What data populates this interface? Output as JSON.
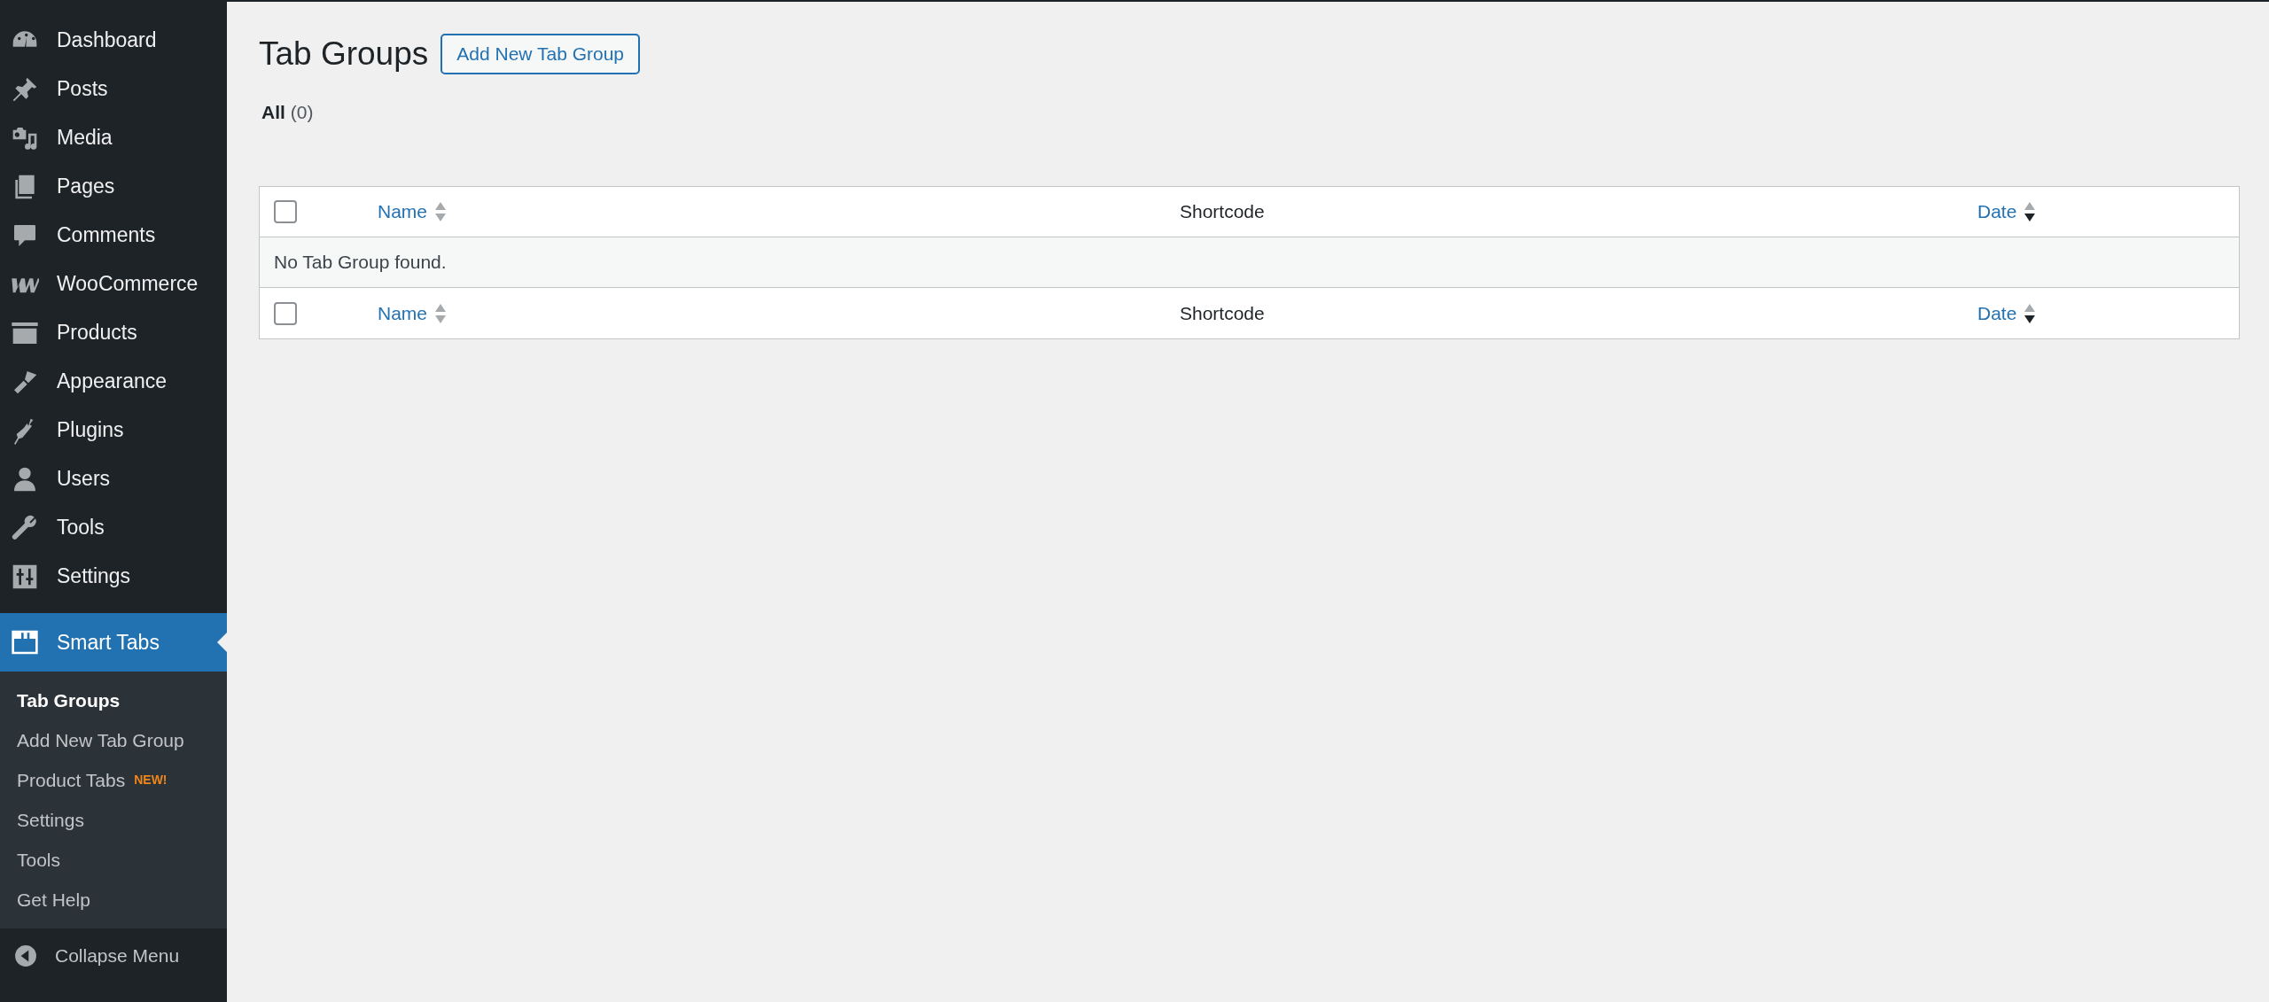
{
  "sidebar": {
    "menu": [
      {
        "label": "Dashboard",
        "selected": false
      },
      {
        "label": "Posts",
        "selected": false
      },
      {
        "label": "Media",
        "selected": false
      },
      {
        "label": "Pages",
        "selected": false
      },
      {
        "label": "Comments",
        "selected": false
      },
      {
        "label": "WooCommerce",
        "selected": false
      },
      {
        "label": "Products",
        "selected": false
      },
      {
        "label": "Appearance",
        "selected": false
      },
      {
        "label": "Plugins",
        "selected": false
      },
      {
        "label": "Users",
        "selected": false
      },
      {
        "label": "Tools",
        "selected": false
      },
      {
        "label": "Settings",
        "selected": false
      },
      {
        "label": "Smart Tabs",
        "selected": true,
        "submenu": [
          {
            "label": "Tab Groups",
            "selected": true
          },
          {
            "label": "Add New Tab Group",
            "selected": false
          },
          {
            "label": "Product Tabs",
            "selected": false,
            "badge": "NEW!"
          },
          {
            "label": "Settings",
            "selected": false
          },
          {
            "label": "Tools",
            "selected": false
          },
          {
            "label": "Get Help",
            "selected": false
          }
        ]
      }
    ],
    "collapse": "Collapse Menu"
  },
  "page": {
    "title": "Tab Groups",
    "add_button": "Add New Tab Group",
    "filters": [
      {
        "label": "All",
        "count": "(0)",
        "selected": true
      }
    ]
  },
  "table": {
    "header": {
      "checked": false,
      "columns": [
        {
          "label": "Name",
          "kind": "sortable",
          "sorted_desc": false
        },
        {
          "label": "Shortcode",
          "kind": "plain"
        },
        {
          "label": "Date",
          "kind": "sortable",
          "sorted_desc": true
        }
      ]
    },
    "empty_message": "No Tab Group found.",
    "footer": {
      "checked": false,
      "columns": [
        {
          "label": "Name",
          "kind": "sortable",
          "sorted_desc": false
        },
        {
          "label": "Shortcode",
          "kind": "plain"
        },
        {
          "label": "Date",
          "kind": "sortable",
          "sorted_desc": true
        }
      ]
    }
  }
}
